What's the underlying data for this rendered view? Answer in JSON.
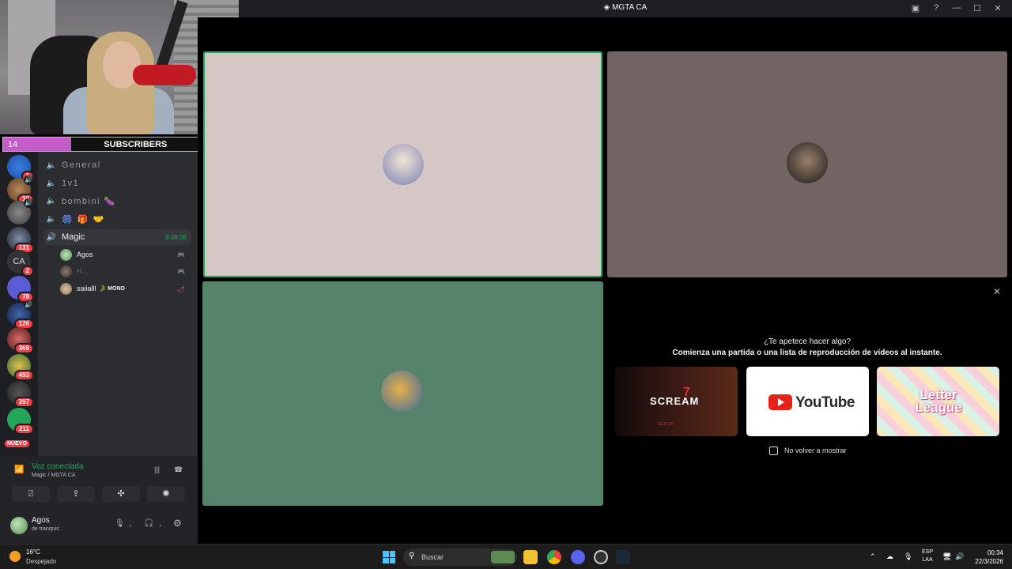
{
  "window": {
    "title": "MGTA CA",
    "title_icon": "discord-icon"
  },
  "stream_overlay": {
    "subscribers": {
      "current": "14",
      "label": "SUBSCRIBERS",
      "goal": "50",
      "progress": 0.28,
      "fill_color": "#c45dc9"
    }
  },
  "servers": [
    {
      "name": "server-1",
      "badge": "1"
    },
    {
      "name": "server-2",
      "badge": "10",
      "speaker": true
    },
    {
      "name": "server-3",
      "speaker": true
    },
    {
      "name": "server-4",
      "badge": "131"
    },
    {
      "name": "server-ca",
      "text": "CA",
      "badge": "2"
    },
    {
      "name": "server-p",
      "badge": "78"
    },
    {
      "name": "server-7",
      "badge": "126",
      "speaker": true
    },
    {
      "name": "server-8",
      "badge": "369"
    },
    {
      "name": "server-9",
      "badge": "493"
    },
    {
      "name": "server-10",
      "badge": "397"
    },
    {
      "name": "server-11",
      "badge": "211"
    }
  ],
  "nuevo_label": "NUEVO",
  "channels": [
    {
      "name": "General"
    },
    {
      "name": "1v1"
    },
    {
      "name": "bombini 🍆"
    },
    {
      "name": "🎆 🎁 🤝"
    },
    {
      "name": "Magic",
      "time": "9:08:08",
      "active": true
    }
  ],
  "voice_users": [
    {
      "name": "Agos"
    },
    {
      "name": "H..."
    },
    {
      "name": "saiialll",
      "tag": "🐊 MONO"
    }
  ],
  "voice_panel": {
    "status": "Voz conectada",
    "location": "Magic / MGTA CA"
  },
  "user": {
    "name": "Agos",
    "status": "de tranquis"
  },
  "activities": {
    "question": "¿Te apetece hacer algo?",
    "subtitle": "Comienza una partida o una lista de reproducción de vídeos al instante.",
    "cards": [
      {
        "title": "SCREAM",
        "number": "7",
        "date": "02.27.26"
      },
      {
        "title": "YouTube"
      },
      {
        "title": "Letter League"
      }
    ],
    "dont_show": "No volver a mostrar"
  },
  "taskbar": {
    "temperature": "16°C",
    "condition": "Despejado",
    "search_placeholder": "Buscar",
    "language": "ESP",
    "layout": "LAA",
    "time": "00:34",
    "date": "22/3/2026"
  },
  "colors": {
    "voice_green": "#23a55a",
    "accent_pink": "#c45dc9",
    "tile_1": "#d6c7c7",
    "tile_2": "#716462",
    "tile_3": "#558369"
  }
}
